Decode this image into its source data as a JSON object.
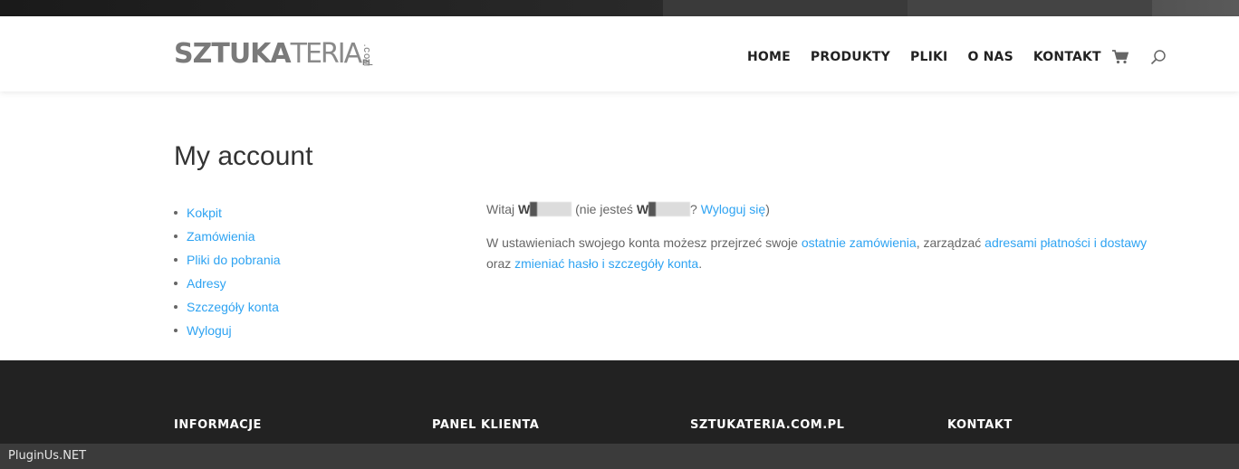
{
  "logo": {
    "bold": "SZTUKA",
    "thin": "TERIA",
    "suffix_top": ".COM",
    "suffix_bottom": "PL"
  },
  "nav": [
    "HOME",
    "PRODUKTY",
    "PLIKI",
    "O NAS",
    "KONTAKT"
  ],
  "icons": {
    "cart": "cart-icon",
    "search": "search-icon"
  },
  "page_title": "My account",
  "account_nav": [
    "Kokpit",
    "Zamówienia",
    "Pliki do pobrania",
    "Adresy",
    "Szczegóły konta",
    "Wyloguj"
  ],
  "greeting": {
    "hello": "Witaj",
    "name_initial": "W",
    "not_you": "(nie jesteś",
    "name_initial_2": "W",
    "q": "?",
    "logout_link": "Wyloguj się",
    "close": ")"
  },
  "dashboard": {
    "text1": "W ustawieniach swojego konta możesz przejrzeć swoje",
    "link1": "ostatnie zamówienia",
    "text2": ", zarządzać",
    "link2": "adresami płatności i dostawy",
    "text3": "oraz",
    "link3": "zmieniać hasło i szczegóły konta",
    "text4": "."
  },
  "footer": [
    "INFORMACJE",
    "PANEL KLIENTA",
    "SZTUKATERIA.COM.PL",
    "KONTAKT"
  ],
  "watermark": "PluginUs.NET",
  "colors": {
    "link": "#2ea3f2",
    "footer_bg": "#222222",
    "text": "#666666"
  }
}
